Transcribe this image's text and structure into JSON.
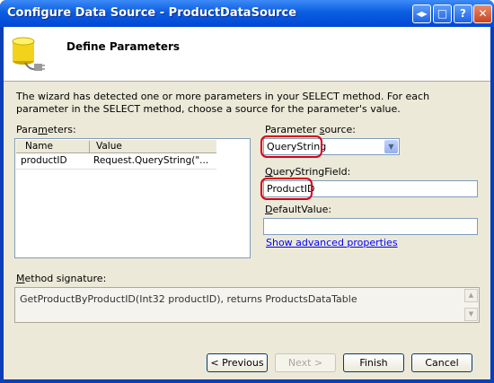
{
  "window": {
    "title": "Configure Data Source - ProductDataSource",
    "controls": {
      "nav_glyph": "◀▶",
      "max_glyph": "□",
      "help_glyph": "?",
      "close_glyph": "✕"
    }
  },
  "header": {
    "heading": "Define Parameters",
    "icon": "database-plug-icon"
  },
  "wizard_text": "The wizard has detected one or more parameters in your SELECT method. For each parameter in the SELECT method, choose a source for the parameter's value.",
  "parameters": {
    "label_pre": "Para",
    "label_key": "m",
    "label_post": "eters:",
    "columns": [
      "Name",
      "Value"
    ],
    "rows": [
      {
        "name": "productID",
        "value": "Request.QueryString(\"..."
      }
    ]
  },
  "parameter_source": {
    "label_pre": "Parameter ",
    "label_key": "s",
    "label_post": "ource:",
    "selected": "QueryString"
  },
  "querystring_field": {
    "label_pre": "",
    "label_key": "Q",
    "label_post": "ueryStringField:",
    "value": "ProductID"
  },
  "default_value": {
    "label_pre": "",
    "label_key": "D",
    "label_post": "efaultValue:",
    "value": ""
  },
  "advanced_link": "Show advanced properties",
  "method_signature": {
    "label_pre": "",
    "label_key": "M",
    "label_post": "ethod signature:",
    "value": "GetProductByProductID(Int32 productID), returns ProductsDataTable"
  },
  "buttons": {
    "previous": "< Previous",
    "next": "Next >",
    "finish": "Finish",
    "cancel": "Cancel"
  },
  "colors": {
    "titlebar": "#0347d6",
    "dialog_bg": "#ece9d8",
    "highlight": "#d8001a",
    "link": "#0000ff"
  }
}
